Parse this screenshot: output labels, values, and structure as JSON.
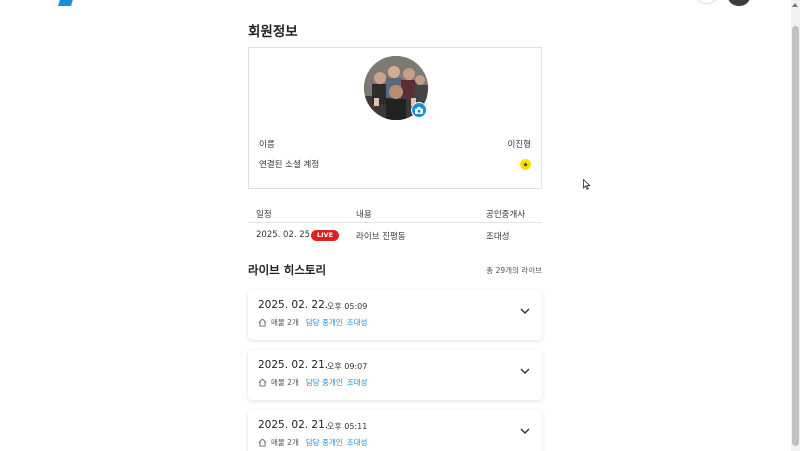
{
  "profile": {
    "title": "회원정보",
    "name_label": "이름",
    "name_value": "이진형",
    "social_label": "연결된 소셜 계정",
    "social_icon": "kakao-icon"
  },
  "schedule": {
    "headers": [
      "일정",
      "내용",
      "공인중개사"
    ],
    "rows": [
      {
        "date": "2025. 02. 25.",
        "badge": "LIVE",
        "content": "라이브 진평동",
        "agent": "조대성"
      }
    ]
  },
  "history": {
    "title": "라이브 히스토리",
    "count": "총 29개의 라이브",
    "items": [
      {
        "date": "2025. 02. 22.",
        "time": "오후 05:09",
        "property": "매물 2개",
        "agent_label": "담당 중개인",
        "agent_name": "조대성"
      },
      {
        "date": "2025. 02. 21.",
        "time": "오후 09:07",
        "property": "매물 2개",
        "agent_label": "담당 중개인",
        "agent_name": "조대성"
      },
      {
        "date": "2025. 02. 21.",
        "time": "오후 05:11",
        "property": "매물 2개",
        "agent_label": "담당 중개인",
        "agent_name": "조대성"
      }
    ]
  },
  "colors": {
    "accent": "#1a8fd6",
    "live": "#e02020",
    "kakao": "#f7e000"
  }
}
